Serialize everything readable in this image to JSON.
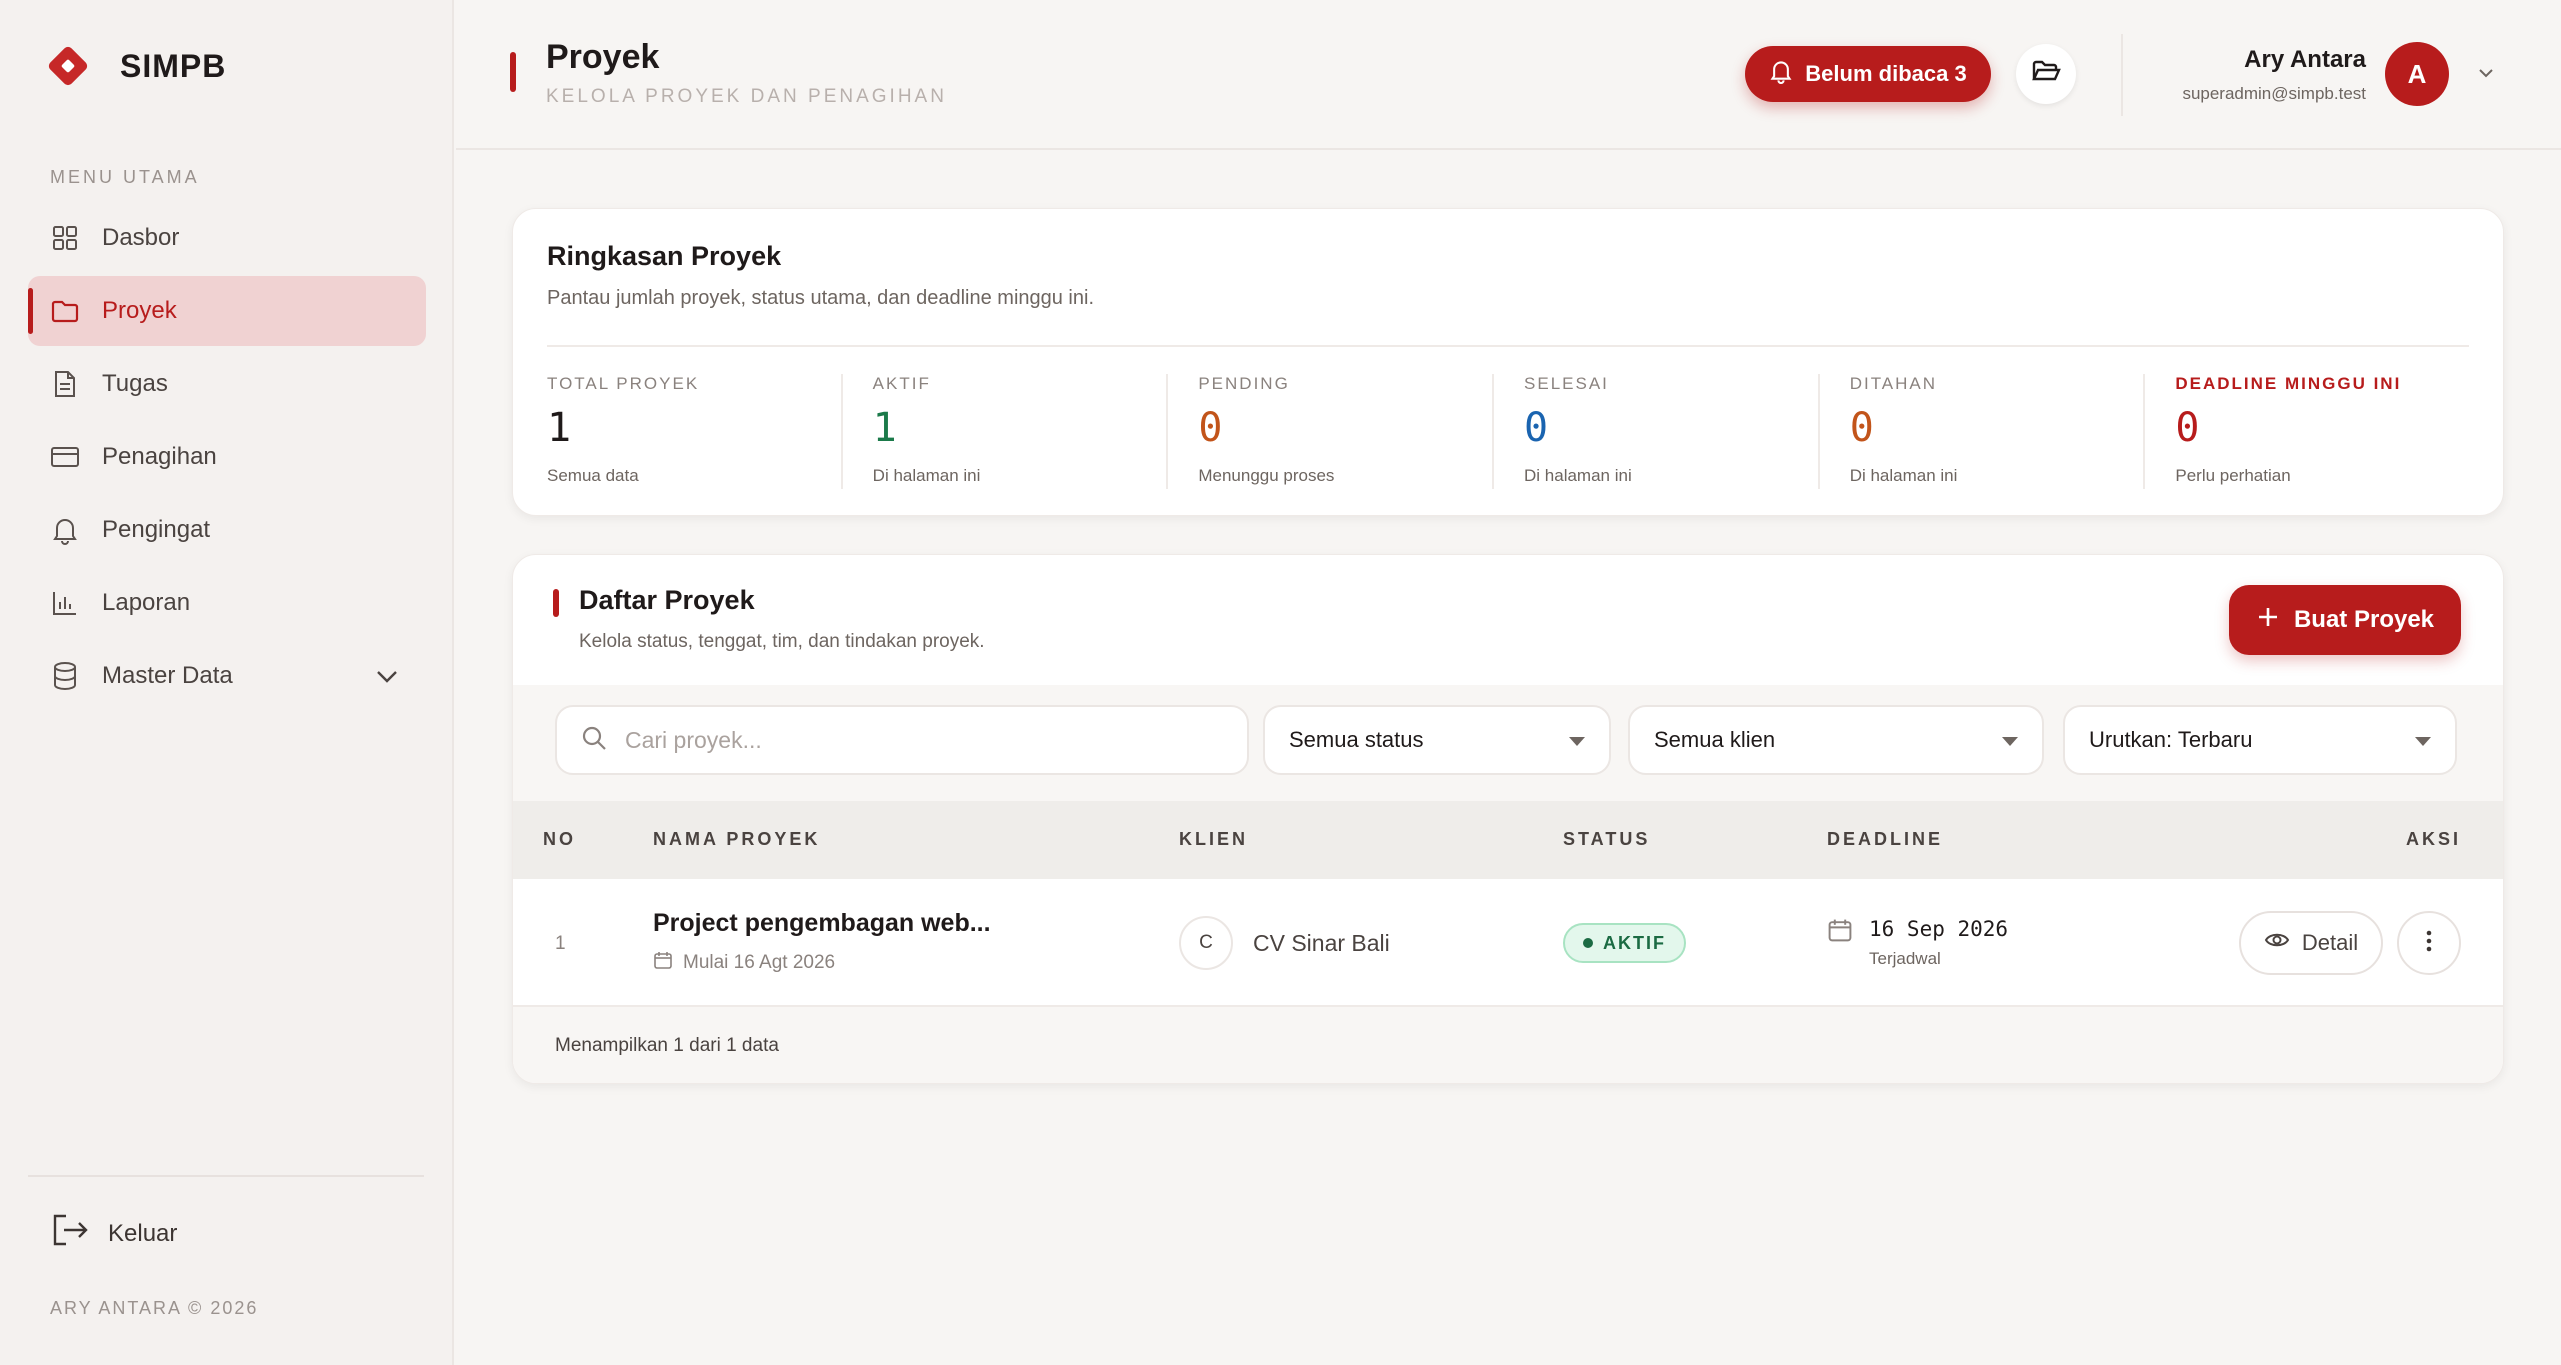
{
  "app": {
    "name": "SIMPB",
    "copyright": "ARY ANTARA © 2026",
    "accent": "#b71c1c"
  },
  "sidebar": {
    "heading": "MENU UTAMA",
    "items": [
      {
        "label": "Dasbor",
        "icon": "grid-icon"
      },
      {
        "label": "Proyek",
        "icon": "folder-icon",
        "active": true
      },
      {
        "label": "Tugas",
        "icon": "document-icon"
      },
      {
        "label": "Penagihan",
        "icon": "credit-card-icon"
      },
      {
        "label": "Pengingat",
        "icon": "bell-icon"
      },
      {
        "label": "Laporan",
        "icon": "bar-chart-icon"
      },
      {
        "label": "Master Data",
        "icon": "database-icon",
        "expandable": true
      }
    ],
    "logout": "Keluar"
  },
  "header": {
    "title": "Proyek",
    "subtitle": "KELOLA PROYEK DAN PENAGIHAN",
    "notification": "Belum dibaca 3",
    "user": {
      "name": "Ary Antara",
      "email": "superadmin@simpb.test",
      "initial": "A"
    }
  },
  "summary": {
    "title": "Ringkasan Proyek",
    "subtitle": "Pantau jumlah proyek, status utama, dan deadline minggu ini.",
    "stats": [
      {
        "label": "TOTAL PROYEK",
        "value": "1",
        "note": "Semua data",
        "color": "#1f1a1a"
      },
      {
        "label": "AKTIF",
        "value": "1",
        "note": "Di halaman ini",
        "color": "#1b7a4a"
      },
      {
        "label": "PENDING",
        "value": "0",
        "note": "Menunggu proses",
        "color": "#c2541a"
      },
      {
        "label": "SELESAI",
        "value": "0",
        "note": "Di halaman ini",
        "color": "#1a64b0"
      },
      {
        "label": "DITAHAN",
        "value": "0",
        "note": "Di halaman ini",
        "color": "#c2541a"
      },
      {
        "label": "DEADLINE MINGGU INI",
        "value": "0",
        "note": "Perlu perhatian",
        "color": "#b71c1c"
      }
    ]
  },
  "projects": {
    "title": "Daftar Proyek",
    "subtitle": "Kelola status, tenggat, tim, dan tindakan proyek.",
    "create_label": "Buat Proyek",
    "search_placeholder": "Cari proyek...",
    "filters": {
      "status": "Semua status",
      "client": "Semua klien",
      "sort": "Urutkan: Terbaru"
    },
    "columns": {
      "no": "NO",
      "name": "NAMA PROYEK",
      "client": "KLIEN",
      "status": "STATUS",
      "deadline": "DEADLINE",
      "actions": "AKSI"
    },
    "rows": [
      {
        "no": "1",
        "name": "Project pengembagan web...",
        "start": "Mulai 16 Agt 2026",
        "client_initial": "C",
        "client": "CV Sinar Bali",
        "status": "AKTIF",
        "deadline": "16 Sep 2026",
        "deadline_note": "Terjadwal",
        "detail_label": "Detail"
      }
    ],
    "footer": "Menampilkan 1 dari 1 data"
  }
}
